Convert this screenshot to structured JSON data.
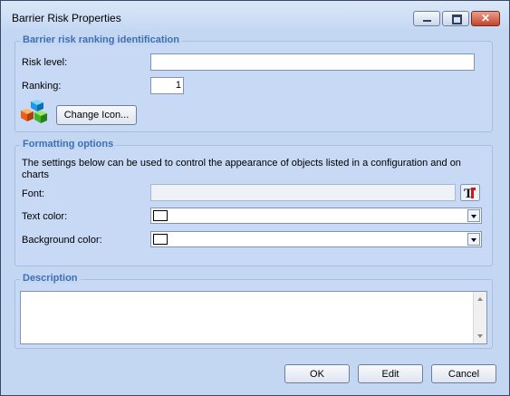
{
  "window": {
    "title": "Barrier Risk Properties"
  },
  "identification": {
    "title": "Barrier risk ranking identification",
    "risk_level_label": "Risk level:",
    "risk_level_value": "",
    "ranking_label": "Ranking:",
    "ranking_value": "1",
    "change_icon_label": "Change Icon..."
  },
  "formatting": {
    "title": "Formatting options",
    "description": "The settings below can be used to control the appearance of objects listed in a configuration and on charts",
    "font_label": "Font:",
    "font_value": "",
    "text_color_label": "Text color:",
    "text_color": "#ffffff",
    "background_color_label": "Background color:",
    "background_color": "#ffffff"
  },
  "description_group": {
    "title": "Description",
    "value": ""
  },
  "buttons": {
    "ok": "OK",
    "edit": "Edit",
    "cancel": "Cancel"
  },
  "icons": {
    "app": "colored-cubes-icon",
    "font": "font-picker-icon"
  }
}
